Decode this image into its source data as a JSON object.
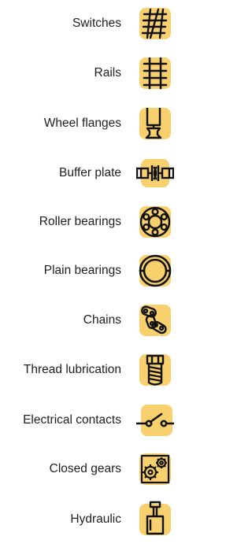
{
  "accent_color": "#F9D06E",
  "ink_color": "#111111",
  "items": [
    {
      "label": "Switches",
      "icon": "switches-icon"
    },
    {
      "label": "Rails",
      "icon": "rails-icon"
    },
    {
      "label": "Wheel flanges",
      "icon": "wheel-flange-icon"
    },
    {
      "label": "Buffer plate",
      "icon": "buffer-plate-icon"
    },
    {
      "label": "Roller bearings",
      "icon": "roller-bearing-icon"
    },
    {
      "label": "Plain bearings",
      "icon": "plain-bearing-icon"
    },
    {
      "label": "Chains",
      "icon": "chain-icon"
    },
    {
      "label": "Thread lubrication",
      "icon": "bolt-thread-icon"
    },
    {
      "label": "Electrical contacts",
      "icon": "electrical-switch-icon"
    },
    {
      "label": "Closed gears",
      "icon": "gearbox-icon"
    },
    {
      "label": "Hydraulic",
      "icon": "hydraulic-cylinder-icon"
    }
  ]
}
